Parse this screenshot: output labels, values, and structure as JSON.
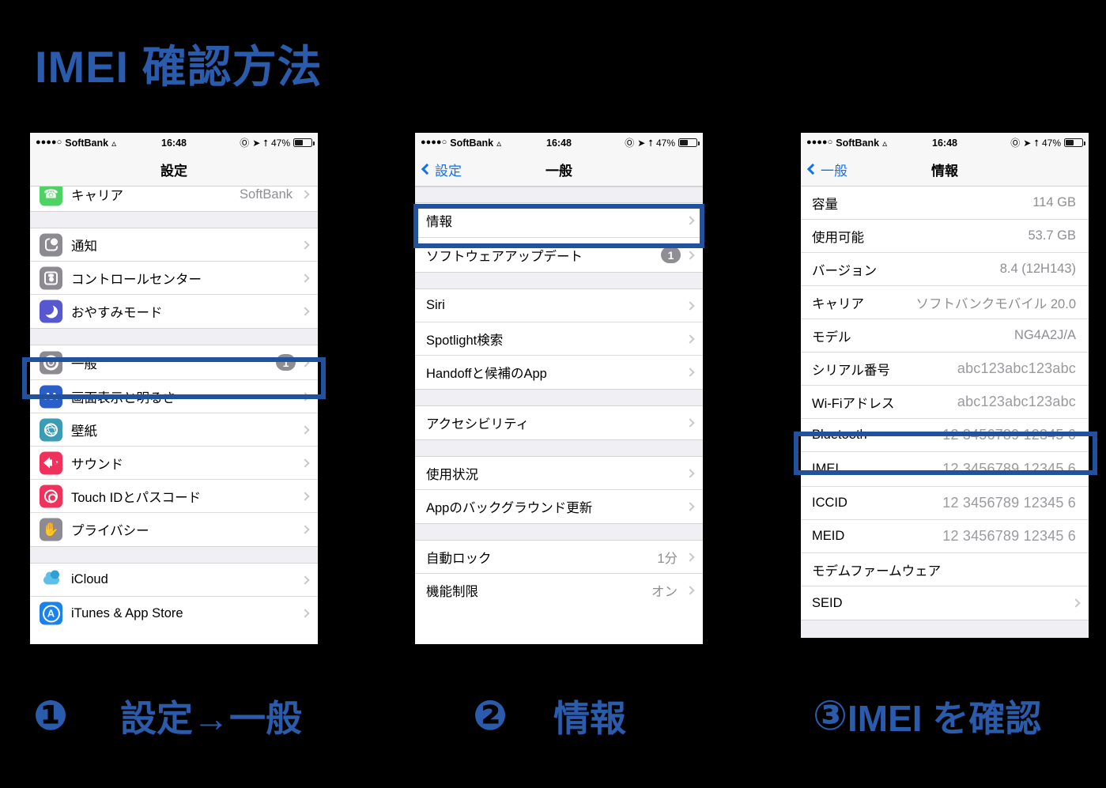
{
  "title": "IMEI 確認方法",
  "colors": {
    "accent_blue": "#2b5bab",
    "highlight_blue": "#22519e",
    "link_blue": "#1272e8",
    "value_gray": "#8e8e93"
  },
  "status_bar": {
    "signal_dots": "●●●●○",
    "carrier": "SoftBank",
    "wifi_icon": "wifi-icon",
    "time": "16:48",
    "rotation_lock_icon": "rotation-lock-icon",
    "location_icon": "location-arrow-icon",
    "bluetooth_icon": "bluetooth-icon",
    "battery_percent": "47%",
    "battery_icon": "battery-icon"
  },
  "phone1": {
    "nav": {
      "title": "設定"
    },
    "rows": [
      {
        "icon": "phone-icon",
        "label": "キャリア",
        "value": "SoftBank",
        "chevron": true
      },
      {
        "icon": "notifications-icon",
        "label": "通知",
        "value": "",
        "chevron": true
      },
      {
        "icon": "control-center-icon",
        "label": "コントロールセンター",
        "value": "",
        "chevron": true
      },
      {
        "icon": "do-not-disturb-icon",
        "label": "おやすみモード",
        "value": "",
        "chevron": true
      },
      {
        "icon": "gear-icon",
        "label": "一般",
        "badge": "1",
        "chevron": true
      },
      {
        "icon": "display-brightness-icon",
        "label": "画面表示と明るさ",
        "value": "",
        "chevron": true
      },
      {
        "icon": "wallpaper-icon",
        "label": "壁紙",
        "value": "",
        "chevron": true
      },
      {
        "icon": "sound-icon",
        "label": "サウンド",
        "value": "",
        "chevron": true
      },
      {
        "icon": "touch-id-icon",
        "label": "Touch IDとパスコード",
        "value": "",
        "chevron": true
      },
      {
        "icon": "privacy-icon",
        "label": "プライバシー",
        "value": "",
        "chevron": true
      },
      {
        "icon": "icloud-icon",
        "label": "iCloud",
        "value": "",
        "chevron": true
      },
      {
        "icon": "itunes-appstore-icon",
        "label": "iTunes & App Store",
        "value": "",
        "chevron": true
      }
    ]
  },
  "phone2": {
    "nav": {
      "back": "設定",
      "title": "一般"
    },
    "rows": [
      {
        "label": "情報",
        "value": "",
        "chevron": true
      },
      {
        "label": "ソフトウェアアップデート",
        "badge": "1",
        "chevron": true
      },
      {
        "label": "Siri",
        "value": "",
        "chevron": true
      },
      {
        "label": "Spotlight検索",
        "value": "",
        "chevron": true
      },
      {
        "label": "Handoffと候補のApp",
        "value": "",
        "chevron": true
      },
      {
        "label": "アクセシビリティ",
        "value": "",
        "chevron": true
      },
      {
        "label": "使用状況",
        "value": "",
        "chevron": true
      },
      {
        "label": "Appのバックグラウンド更新",
        "value": "",
        "chevron": true
      },
      {
        "label": "自動ロック",
        "value": "1分",
        "chevron": true
      },
      {
        "label": "機能制限",
        "value": "オン",
        "chevron": true
      }
    ]
  },
  "phone3": {
    "nav": {
      "back": "一般",
      "title": "情報"
    },
    "rows": [
      {
        "label": "容量",
        "value": "114 GB"
      },
      {
        "label": "使用可能",
        "value": "53.7 GB"
      },
      {
        "label": "バージョン",
        "value": "8.4 (12H143)"
      },
      {
        "label": "キャリア",
        "value": "ソフトバンクモバイル 20.0"
      },
      {
        "label": "モデル",
        "value": "NG4A2J/A"
      },
      {
        "label": "シリアル番号",
        "value": "abc123abc123abc"
      },
      {
        "label": "Wi-Fiアドレス",
        "value": "abc123abc123abc"
      },
      {
        "label": "Bluetooth",
        "value": "12 3456789 12345 6"
      },
      {
        "label": "IMEI",
        "value": "12 3456789 12345 6"
      },
      {
        "label": "ICCID",
        "value": "12 3456789 12345 6"
      },
      {
        "label": "MEID",
        "value": "12 3456789 12345 6"
      },
      {
        "label": "モデムファームウェア",
        "value": ""
      },
      {
        "label": "SEID",
        "value": "",
        "chevron": true
      }
    ]
  },
  "captions": [
    {
      "num": "❶",
      "text": "設定→一般"
    },
    {
      "num": "❷",
      "text": "情報"
    },
    {
      "num": "③",
      "text": "IMEI を確認"
    }
  ]
}
